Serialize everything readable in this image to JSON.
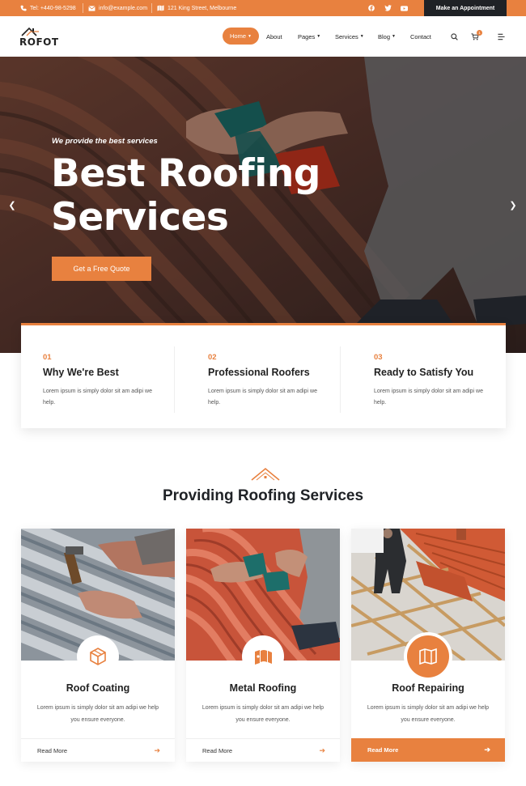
{
  "topbar": {
    "phone": "Tel: +440-98-5298",
    "email": "info@example.com",
    "address": "121 King Street, Melbourne",
    "social_icons": [
      "facebook-icon",
      "twitter-icon",
      "youtube-icon"
    ],
    "appointment_label": "Make an Appointment"
  },
  "nav": {
    "logo_text": "ROFOT",
    "home": "Home",
    "about": "About",
    "pages": "Pages",
    "services": "Services",
    "blog": "Blog",
    "contact": "Contact",
    "cart_count": "1"
  },
  "hero": {
    "tagline": "We provide the best services",
    "title_line1": "Best Roofing",
    "title_line2": "Services",
    "button_label": "Get a Free Quote"
  },
  "features": [
    {
      "num": "01",
      "title": "Why We're Best",
      "desc": "Lorem ipsum is simply dolor sit am adipi we help."
    },
    {
      "num": "02",
      "title": "Professional Roofers",
      "desc": "Lorem ipsum is simply dolor sit am adipi we help."
    },
    {
      "num": "03",
      "title": "Ready to Satisfy You",
      "desc": "Lorem ipsum is simply dolor sit am adipi we help."
    }
  ],
  "services_section": {
    "title": "Providing Roofing Services",
    "cards": [
      {
        "title": "Roof Coating",
        "desc": "Lorem ipsum is simply dolor sit am adipi we help you ensure everyone.",
        "read_more": "Read More",
        "icon": "cube-icon"
      },
      {
        "title": "Metal Roofing",
        "desc": "Lorem ipsum is simply dolor sit am adipi we help you ensure everyone.",
        "read_more": "Read More",
        "icon": "metal-sheet-icon"
      },
      {
        "title": "Roof Repairing",
        "desc": "Lorem ipsum is simply dolor sit am adipi we help you ensure everyone.",
        "read_more": "Read More",
        "icon": "map-icon"
      }
    ]
  },
  "colors": {
    "accent": "#e8813f",
    "dark": "#1f2226"
  }
}
